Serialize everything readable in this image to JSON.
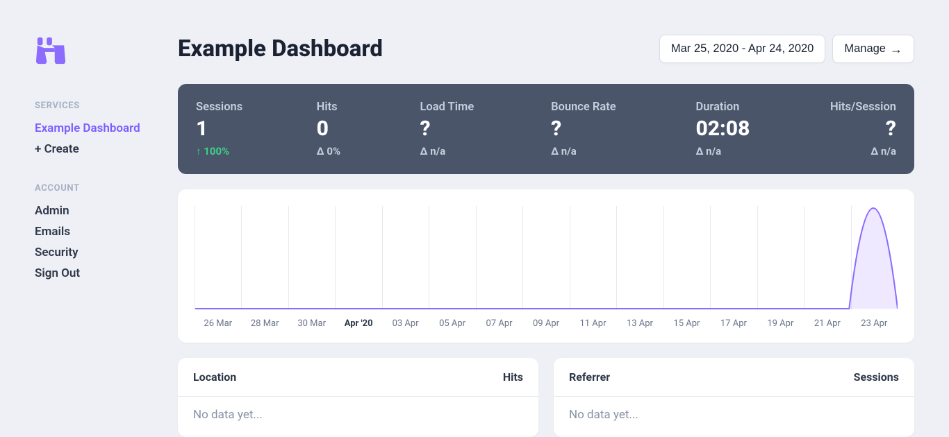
{
  "sidebar": {
    "sections": [
      {
        "label": "SERVICES",
        "items": [
          {
            "label": "Example Dashboard",
            "active": true
          },
          {
            "label": "+ Create",
            "active": false
          }
        ]
      },
      {
        "label": "ACCOUNT",
        "items": [
          {
            "label": "Admin",
            "active": false
          },
          {
            "label": "Emails",
            "active": false
          },
          {
            "label": "Security",
            "active": false
          },
          {
            "label": "Sign Out",
            "active": false
          }
        ]
      }
    ]
  },
  "header": {
    "title": "Example Dashboard",
    "date_range": "Mar 25, 2020 - Apr 24, 2020",
    "manage_label": "Manage"
  },
  "stats": [
    {
      "label": "Sessions",
      "value": "1",
      "delta": "↑ 100%",
      "delta_class": "up"
    },
    {
      "label": "Hits",
      "value": "0",
      "delta": "Δ 0%",
      "delta_class": ""
    },
    {
      "label": "Load Time",
      "value": "?",
      "delta": "Δ n/a",
      "delta_class": ""
    },
    {
      "label": "Bounce Rate",
      "value": "?",
      "delta": "Δ n/a",
      "delta_class": ""
    },
    {
      "label": "Duration",
      "value": "02:08",
      "delta": "Δ n/a",
      "delta_class": ""
    },
    {
      "label": "Hits/Session",
      "value": "?",
      "delta": "Δ n/a",
      "delta_class": ""
    }
  ],
  "chart_data": {
    "type": "area",
    "title": "",
    "xlabel": "",
    "ylabel": "",
    "ylim": [
      0,
      1
    ],
    "categories": [
      "26 Mar",
      "28 Mar",
      "30 Mar",
      "Apr '20",
      "03 Apr",
      "05 Apr",
      "07 Apr",
      "09 Apr",
      "11 Apr",
      "13 Apr",
      "15 Apr",
      "17 Apr",
      "19 Apr",
      "21 Apr",
      "23 Apr"
    ],
    "bold_tick_index": 3,
    "series": [
      {
        "name": "Sessions",
        "values": [
          0,
          0,
          0,
          0,
          0,
          0,
          0,
          0,
          0,
          0,
          0,
          0,
          0,
          0,
          0,
          0,
          0,
          0,
          0,
          0,
          0,
          0,
          0,
          0,
          0,
          0,
          0,
          0,
          1,
          0
        ]
      }
    ],
    "color": "#8b6cff",
    "fill": "rgba(139,108,255,0.15)"
  },
  "panels": {
    "location": {
      "title": "Location",
      "metric": "Hits",
      "empty": "No data yet..."
    },
    "referrer": {
      "title": "Referrer",
      "metric": "Sessions",
      "empty": "No data yet..."
    }
  }
}
